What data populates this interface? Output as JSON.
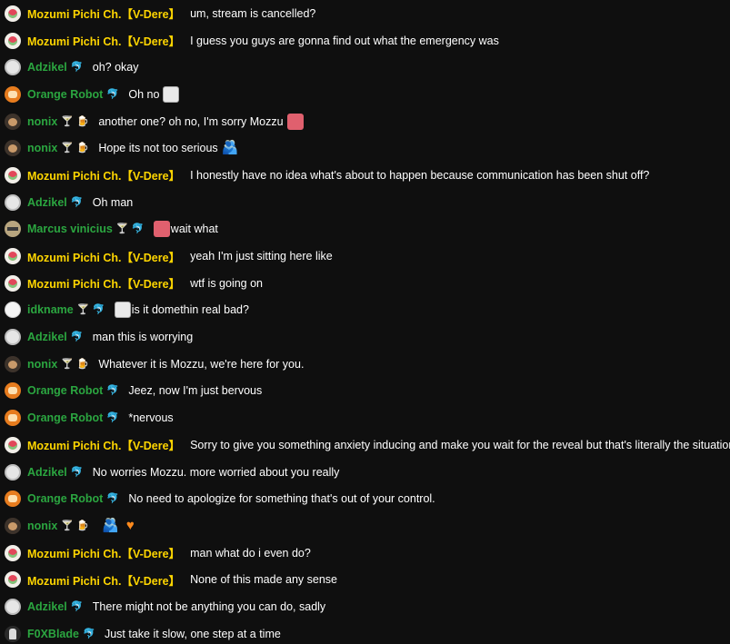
{
  "chat": {
    "messages": [
      {
        "author": "Mozumi Pichi Ch.【V-Dere】",
        "role": "owner",
        "avatar": "mozumi",
        "badges": [],
        "text": "um, stream is cancelled?",
        "emojis": []
      },
      {
        "author": "Mozumi Pichi Ch.【V-Dere】",
        "role": "owner",
        "avatar": "mozumi",
        "badges": [],
        "text": "I guess you guys are gonna find out what the emergency was",
        "emojis": []
      },
      {
        "author": "Adzikel",
        "role": "member",
        "avatar": "adzikel",
        "badges": [
          "membership-badge"
        ],
        "text": "oh? okay",
        "emojis": []
      },
      {
        "author": "Orange Robot",
        "role": "member",
        "avatar": "orange",
        "badges": [
          "membership-badge"
        ],
        "text": "Oh no",
        "emojis": [
          "emoji-white"
        ]
      },
      {
        "author": "nonix",
        "role": "member",
        "avatar": "nonix",
        "badges": [
          "drink-badge",
          "cup-badge"
        ],
        "text": "another one? oh no, I'm sorry Mozzu",
        "emojis": [
          "emoji-pink"
        ]
      },
      {
        "author": "nonix",
        "role": "member",
        "avatar": "nonix",
        "badges": [
          "drink-badge",
          "cup-badge"
        ],
        "text": "Hope its not too serious",
        "emojis": [
          "emoji-blue"
        ]
      },
      {
        "author": "Mozumi Pichi Ch.【V-Dere】",
        "role": "owner",
        "avatar": "mozumi",
        "badges": [],
        "text": "I honestly have no idea what's about to happen because communication has been shut off?",
        "emojis": []
      },
      {
        "author": "Adzikel",
        "role": "member",
        "avatar": "adzikel",
        "badges": [
          "membership-badge"
        ],
        "text": "Oh man",
        "emojis": []
      },
      {
        "author": "Marcus vinicius",
        "role": "member",
        "avatar": "marcus",
        "badges": [
          "drink-badge",
          "membership-badge"
        ],
        "text": "wait what",
        "emojis_before": [
          "emoji-pink"
        ],
        "emojis": []
      },
      {
        "author": "Mozumi Pichi Ch.【V-Dere】",
        "role": "owner",
        "avatar": "mozumi",
        "badges": [],
        "text": "yeah I'm just sitting here like",
        "emojis": []
      },
      {
        "author": "Mozumi Pichi Ch.【V-Dere】",
        "role": "owner",
        "avatar": "mozumi",
        "badges": [],
        "text": "wtf is going on",
        "emojis": []
      },
      {
        "author": "idkname",
        "role": "member",
        "avatar": "idk",
        "badges": [
          "drink-badge",
          "membership-badge"
        ],
        "text": "is it domethin real bad?",
        "emojis_before": [
          "emoji-white"
        ],
        "emojis": []
      },
      {
        "author": "Adzikel",
        "role": "member",
        "avatar": "adzikel",
        "badges": [
          "membership-badge"
        ],
        "text": "man this is worrying",
        "emojis": []
      },
      {
        "author": "nonix",
        "role": "member",
        "avatar": "nonix",
        "badges": [
          "drink-badge",
          "cup-badge"
        ],
        "text": "Whatever it is Mozzu, we're here for you.",
        "emojis": []
      },
      {
        "author": "Orange Robot",
        "role": "member",
        "avatar": "orange",
        "badges": [
          "membership-badge"
        ],
        "text": "Jeez, now I'm just bervous",
        "emojis": []
      },
      {
        "author": "Orange Robot",
        "role": "member",
        "avatar": "orange",
        "badges": [
          "membership-badge"
        ],
        "text": "*nervous",
        "emojis": []
      },
      {
        "author": "Mozumi Pichi Ch.【V-Dere】",
        "role": "owner",
        "avatar": "mozumi",
        "badges": [],
        "text": "Sorry to give you something anxiety inducing and make you wait for the reveal but that's literally the situation I'm in rn",
        "emojis": []
      },
      {
        "author": "Adzikel",
        "role": "member",
        "avatar": "adzikel",
        "badges": [
          "membership-badge"
        ],
        "text": "No worries Mozzu. more worried about you really",
        "emojis": []
      },
      {
        "author": "Orange Robot",
        "role": "member",
        "avatar": "orange",
        "badges": [
          "membership-badge"
        ],
        "text": "No need to apologize for something that's out of your control.",
        "emojis": []
      },
      {
        "author": "nonix",
        "role": "member",
        "avatar": "nonix",
        "badges": [
          "drink-badge",
          "cup-badge"
        ],
        "text": "",
        "emojis": [
          "emoji-blue",
          "emoji-heart"
        ]
      },
      {
        "author": "Mozumi Pichi Ch.【V-Dere】",
        "role": "owner",
        "avatar": "mozumi",
        "badges": [],
        "text": "man what do i even do?",
        "emojis": []
      },
      {
        "author": "Mozumi Pichi Ch.【V-Dere】",
        "role": "owner",
        "avatar": "mozumi",
        "badges": [],
        "text": "None of this made any sense",
        "emojis": []
      },
      {
        "author": "Adzikel",
        "role": "member",
        "avatar": "adzikel",
        "badges": [
          "membership-badge"
        ],
        "text": "There might not be anything you can do, sadly",
        "emojis": []
      },
      {
        "author": "F0XBlade",
        "role": "member",
        "avatar": "fox",
        "badges": [
          "membership-badge"
        ],
        "text": "Just take it slow, one step at a time",
        "emojis": []
      }
    ]
  },
  "colors": {
    "background": "#0f0f0f",
    "owner_name": "#ffd600",
    "member_name": "#2ba640",
    "message_text": "#ffffff"
  }
}
